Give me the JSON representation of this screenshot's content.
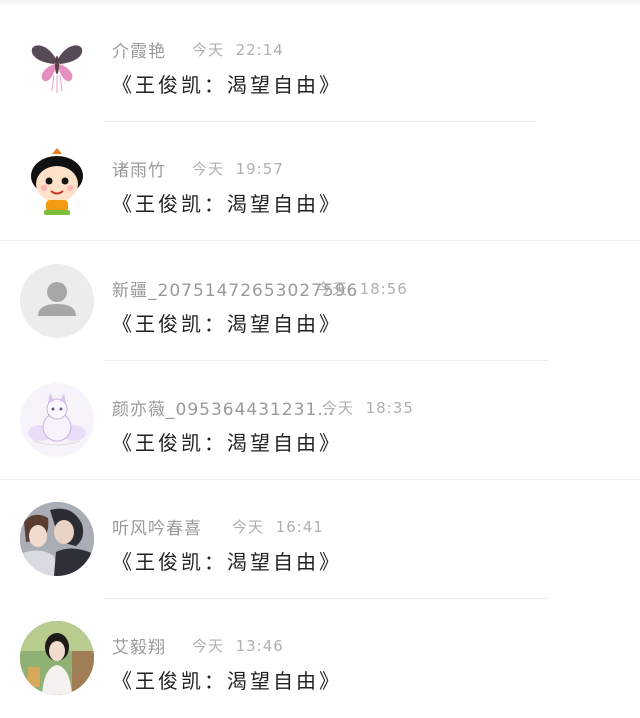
{
  "comments": [
    {
      "user": "介霞艳",
      "day": "今天",
      "time": "22:14",
      "text": "《王俊凯：渴望自由》",
      "avatar_icon": "butterfly-avatar-icon"
    },
    {
      "user": "诸雨竹",
      "day": "今天",
      "time": "19:57",
      "text": "《王俊凯：渴望自由》",
      "avatar_icon": "cartoon-kid-avatar-icon"
    },
    {
      "user": "新疆_20751472653027596",
      "day": "今天",
      "time": "18:56",
      "text": "《王俊凯：渴望自由》",
      "avatar_icon": "default-user-avatar-icon"
    },
    {
      "user": "颜亦薇_095364431231…",
      "day": "今天",
      "time": "18:35",
      "text": "《王俊凯：渴望自由》",
      "avatar_icon": "fox-avatar-icon"
    },
    {
      "user": "听风吟春喜",
      "day": "今天",
      "time": "16:41",
      "text": "《王俊凯：渴望自由》",
      "avatar_icon": "anime-couple-avatar-icon"
    },
    {
      "user": "艾毅翔",
      "day": "今天",
      "time": "13:46",
      "text": "《王俊凯：渴望自由》",
      "avatar_icon": "photo-girl-avatar-icon"
    }
  ]
}
